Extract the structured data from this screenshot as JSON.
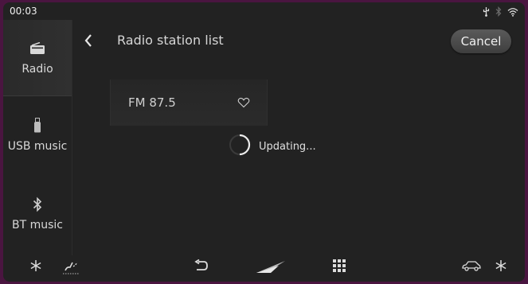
{
  "statusbar": {
    "time": "00:03",
    "icons": [
      "usb-icon",
      "bluetooth-icon",
      "wifi-icon"
    ]
  },
  "sidebar": {
    "items": [
      {
        "label": "Radio",
        "icon": "radio-icon",
        "active": true
      },
      {
        "label": "USB music",
        "icon": "usb-drive-icon",
        "active": false
      },
      {
        "label": "BT music",
        "icon": "bluetooth-icon",
        "active": false
      }
    ]
  },
  "header": {
    "title": "Radio station list",
    "cancel_label": "Cancel"
  },
  "stations": [
    {
      "name": "FM 87.5",
      "favorite_icon": "heart-outline-icon"
    }
  ],
  "status": {
    "updating_text": "Updating..."
  },
  "bottombar": {
    "icons": [
      "snowflake-icon",
      "seat-heat-icon",
      "back-icon",
      "home-logo-icon",
      "apps-grid-icon",
      "car-icon",
      "snowflake-icon"
    ]
  },
  "colors": {
    "frame": "#4a1540",
    "background": "#222222",
    "text": "#e8e8e8"
  }
}
